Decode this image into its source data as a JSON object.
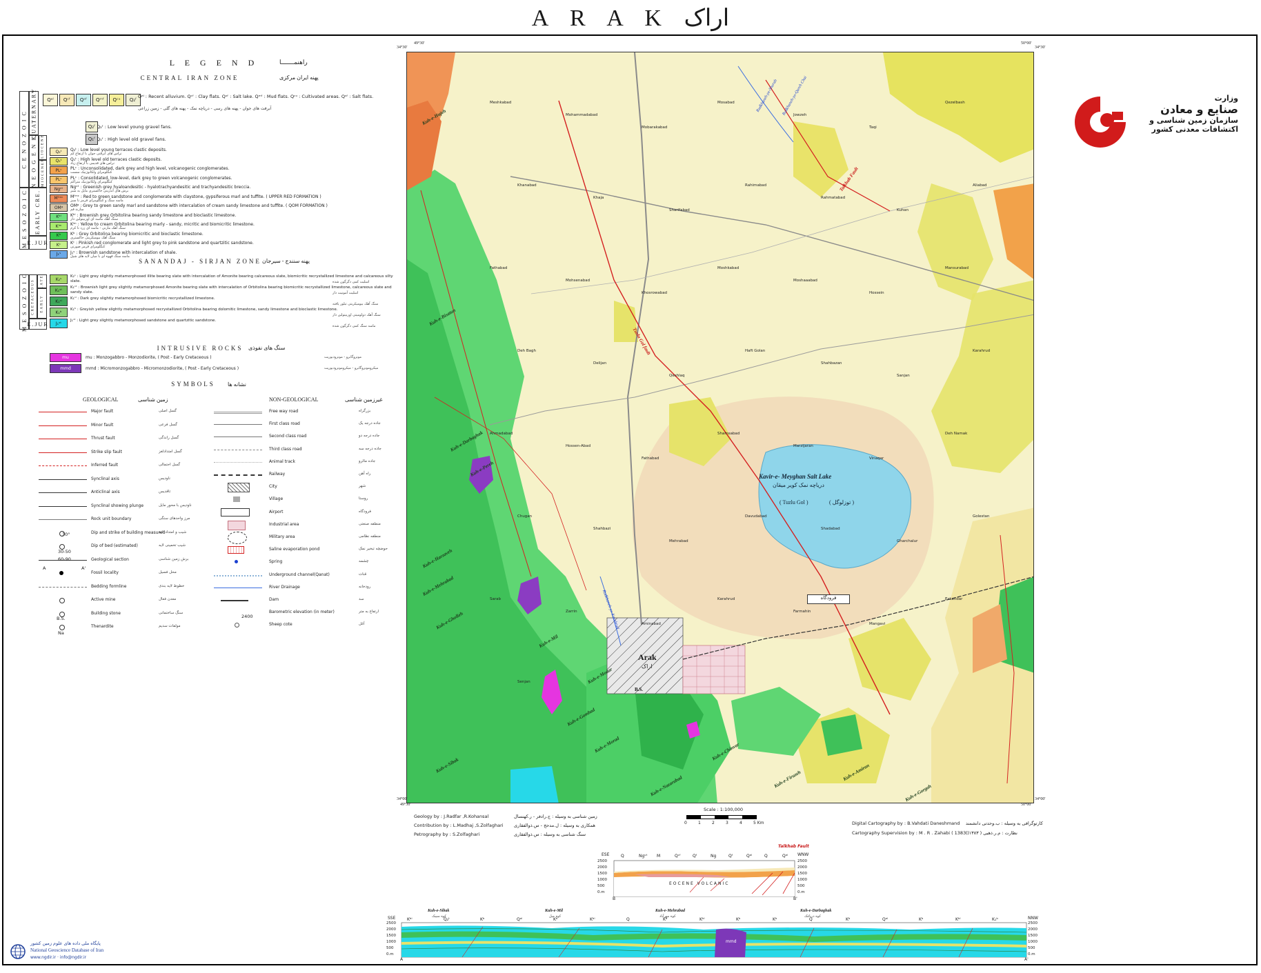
{
  "sheet": {
    "title_latin": "A R A K",
    "title_persian": "اراک"
  },
  "legend": {
    "title": "L E G E N D",
    "title_fa": "راهنمـــــــا",
    "central_zone": "CENTRAL IRAN ZONE",
    "central_zone_fa": "پهنه ایران مرکزی",
    "sanandaj_zone": "SANANDAJ - SIRJAN ZONE",
    "sanandaj_zone_fa": "پهنه سنندج - سیرجان",
    "intrusive": "INTRUSIVE ROCKS",
    "intrusive_fa": "سنگ های نفوذی",
    "symbols": "SYMBOLS",
    "symbols_fa": "نشانه ها",
    "geological": "GEOLOGICAL",
    "geological_fa": "زمین شناسی",
    "non_geological": "NON-GEOLOGICAL",
    "non_geological_fa": "غیرزمین شناسی",
    "eras": {
      "cenozoic": "C E N O Z O I C",
      "mesozoic": "M E S O Z O I C",
      "mesozoic2": "M E S O Z O I C",
      "quaternary": "QUATERNARY",
      "neogene": "N E O G E N E",
      "early_cre": "EARLY CRE.",
      "ejur": "E.JUR",
      "ejur2": "E.JUR",
      "cretaceous": "CRETACEOUS",
      "late": "LATE",
      "early": "EARLY",
      "pliocene": "PLIOCENE",
      "miocene": "MIOCENE"
    },
    "central_units": [
      {
        "code": "Q₂ᵗ",
        "color": "#f6eab5",
        "text": "Q₂ᵗ : Low level young terraces clastic deposits.",
        "fa": "تراس های آبرفتی جوان با ارتفاع کم"
      },
      {
        "code": "Q₁ᵗ",
        "color": "#e9e36a",
        "text": "Q₁ᵗ : High level old terraces clastic deposits.",
        "fa": "تراس های قدیمی با ارتفاع زیاد"
      },
      {
        "code": "PLᶜ",
        "color": "#f3a24c",
        "text": "PLᶜ : Unconsolidated, dark grey and high level, volcanogenic conglomerates.",
        "fa": "کنگلومرای ولکانوژنیک سست"
      },
      {
        "code": "PLᶜ",
        "color": "#f9c66d",
        "text": "PLᶜ : Consolidated, low-level, dark grey to green volcanogenic conglomerates.",
        "fa": "کنگلومرای ولکانوژنیک متراکم"
      },
      {
        "code": "Ngᵛᵗ",
        "color": "#e7b28a",
        "text": "Ngᵛᵗ : Greenish grey hyaloandesitic - hyalotrachyandesitic and trachyandesitic breccia.",
        "fa": "برش های آندزیتی خاکستری مایل به سبز"
      },
      {
        "code": "Mᶠᵐᶜ",
        "color": "#ee8a58",
        "text": "Mᶠᵐᶜ : Red to green sandstone and conglomerate with claystone, gypsiferous marl and tuffite. ( UPPER RED FORMATION )",
        "fa": "ماسه سنگ و کنگلومرای قرمز تا سبز"
      },
      {
        "code": "OMᵍ",
        "color": "#d7c5a8",
        "text": "OMᵍ : Grey to green sandy marl and sandstone with intercalation of cream sandy limestone and tuffite. ( QOM FORMATION )",
        "fa": "سازند قم"
      },
      {
        "code": "Kᵇˡ",
        "color": "#6fe07e",
        "text": "Kᵇˡ : Brownish grey Orbitolina bearing sandy limestone and bioclastic limestone.",
        "fa": "سنگ آهک ماسه ای اوربیتولین دار"
      },
      {
        "code": "Kˡᵐ",
        "color": "#a8ea6e",
        "text": "Kˡᵐ : Yellow to cream Orbitolina bearing marly - sandy, micritic and biomicritic limestone.",
        "fa": "سنگ آهک مارنی - ماسه ای زرد تا کرم"
      },
      {
        "code": "Kᵇ",
        "color": "#34c94c",
        "text": "Kᵇ : Grey Orbitolina bearing biomicritic and bioclastic limestone.",
        "fa": "سنگ آهک بیومیکریتی خاکستری"
      },
      {
        "code": "Kᶜ",
        "color": "#c6f08a",
        "text": "Kᶜ : Pinkish red conglomerate and light grey to pink sandstone and quartzitic sandstone.",
        "fa": "کنگلومرای قرمز صورتی"
      },
      {
        "code": "J₁ˢ",
        "color": "#6aa8e8",
        "text": "J₁ˢ : Brownish sandstone with intercalation of shale.",
        "fa": "ماسه سنگ قهوه ای با میان لایه های شیل"
      }
    ],
    "sanandaj_units": [
      {
        "code": "K₂ˢ",
        "color": "#a7d86a",
        "text": "K₂ˢ : Light grey slightly metamorphosed illite bearing slate with intercalation of Amonite bearing calcareous slate, biomicritic recrystallized limestone and calcareous silty slate.",
        "fa": "اسلیت کمی دگرگون شده"
      },
      {
        "code": "K₁ˢᵗ",
        "color": "#6fbf5a",
        "text": "K₁ˢᵗ : Brownish light grey slightly metamorphosed Amonite bearing slate with intercalation of Orbitolina bearing biomicritic recrystallized limestone, calcareous slate and sandy slate.",
        "fa": "اسلیت آمونیت دار"
      },
      {
        "code": "K₁ˢˡ",
        "color": "#3ea85a",
        "text": "K₁ˢˡ : Dark grey slightly metamorphosed biomicritic recrystallized limestone.",
        "fa": "سنگ آهک بیومیکریتی تبلور یافته"
      },
      {
        "code": "K₁ᵇ",
        "color": "#8fd27a",
        "text": "K₁ᵇ : Greyish yellow slightly metamorphosed recrystallized Orbitolina bearing dolomitic limestone, sandy limestone and bioclastic limestone.",
        "fa": "سنگ آهک دولومیتی اوربیتولین دار"
      },
      {
        "code": "J₁ˢᵗ",
        "color": "#27d8e8",
        "text": "J₁ˢᵗ : Light grey slightly metamorphosed sandstone and quartzitic sandstone.",
        "fa": "ماسه سنگ کمی دگرگون شده"
      }
    ],
    "quaternary_top": [
      {
        "code": "Qᵃˡ",
        "color": "#fbf6d8"
      },
      {
        "code": "Qᶜᶠ",
        "color": "#f7e9b8"
      },
      {
        "code": "Qˢᶠ",
        "color": "#c7f0ef"
      },
      {
        "code": "Qᵐᶠ",
        "color": "#f2f2c8"
      },
      {
        "code": "Qᶜᵘ",
        "color": "#f6ef9a"
      },
      {
        "code": "Q₂ᶠ",
        "color": "#f0f0d4"
      }
    ],
    "quaternary_top_text": "Qᵃˡ : Recent alluvium.   Qᶜᶠ : Clay flats.   Qˢᶠ : Salt lake.   Qᵐᶠ : Mud flats.   Qᶜᵘ : Cultivated areas.   Qˢᶠ : Salt flats.",
    "quaternary_top_fa": "آبرفت های جوان - پهنه های رسی - دریاچه نمک - پهنه های گلی - زمین زراعی",
    "q2f_text": "Q₂ᶠ : Low level young gravel fans.",
    "q1f_text": "Q₁ᶠ : High level old gravel fans.",
    "intrusive_units": [
      {
        "code": "mu",
        "color": "#e535e0",
        "text": "mu : Monzogabbro - Monzodiorite, ( Post - Early Cretaceous )",
        "fa": "مونزوگابرو - مونزودیوریت"
      },
      {
        "code": "mmd",
        "color": "#7d38b8",
        "text": "mmd : Micromonzogabbro - Micromonzodiorite, ( Post - Early Cretaceous )",
        "fa": "میکرومونزوگابرو - میکرومونزودیوریت"
      }
    ],
    "geo_symbols": [
      {
        "name": "Major fault",
        "fa": "گسل اصلی"
      },
      {
        "name": "Minor fault",
        "fa": "گسل فرعی"
      },
      {
        "name": "Thrust fault",
        "fa": "گسل راندگی"
      },
      {
        "name": "Strike slip fault",
        "fa": "گسل امتدادلغز"
      },
      {
        "name": "Inferred fault",
        "fa": "گسل احتمالی"
      },
      {
        "name": "Synclinal axis",
        "fa": "ناودیس"
      },
      {
        "name": "Anticlinal axis",
        "fa": "تاقدیس"
      },
      {
        "name": "Synclinal showing plunge",
        "fa": "ناودیس با محور مایل"
      },
      {
        "name": "Rock unit boundary",
        "fa": "مرز واحدهای سنگی"
      },
      {
        "name": "Dip and strike of building measured",
        "fa": "شیب و امتداد لایه"
      },
      {
        "name": "Dip of bed (estimated)",
        "fa": "شیب تخمینی لایه"
      },
      {
        "name": "Geological section",
        "fa": "برش زمین شناسی"
      },
      {
        "name": "Fossil locality",
        "fa": "محل فسیل"
      },
      {
        "name": "Bedding formline",
        "fa": "خطوط لایه بندی"
      },
      {
        "name": "Active mine",
        "fa": "معدن فعال"
      },
      {
        "name": "Building stone",
        "fa": "سنگ ساختمانی"
      },
      {
        "name": "Thenardite",
        "fa": "مولفات سدیم"
      }
    ],
    "geo_extra": {
      "dip": "30°",
      "dip2": "30-50",
      "dip3": "60-90",
      "section_a": "A",
      "section_a2": "A'",
      "bs": "B.S.",
      "na": "Na"
    },
    "nongeo_symbols": [
      {
        "name": "Free way road",
        "fa": "بزرگراه"
      },
      {
        "name": "First class road",
        "fa": "جاده درجه یک"
      },
      {
        "name": "Second class road",
        "fa": "جاده درجه دو"
      },
      {
        "name": "Third class road",
        "fa": "جاده درجه سه"
      },
      {
        "name": "Animal track",
        "fa": "جاده مالرو"
      },
      {
        "name": "Railway",
        "fa": "راه آهن"
      },
      {
        "name": "City",
        "fa": "شهر"
      },
      {
        "name": "Village",
        "fa": "روستا"
      },
      {
        "name": "Airport",
        "fa": "فرودگاه"
      },
      {
        "name": "Industrial area",
        "fa": "منطقه صنعتی"
      },
      {
        "name": "Military area",
        "fa": "منطقه نظامی"
      },
      {
        "name": "Saline evaporation pond",
        "fa": "حوضچه تبخیر نمک"
      },
      {
        "name": "Spring",
        "fa": "چشمه"
      },
      {
        "name": "Underground channel(Qanat)",
        "fa": "قنات"
      },
      {
        "name": "River Drainage",
        "fa": "رودخانه"
      },
      {
        "name": "Dam",
        "fa": "سد"
      },
      {
        "name": "Barometric elevation (in meter)",
        "fa": "ارتفاع به متر"
      },
      {
        "name": "Sheep cote",
        "fa": "آغل"
      }
    ],
    "elev_example": "2400"
  },
  "map": {
    "corners": {
      "nw": "34°30'",
      "nw_lon": "49°30'",
      "ne": "34°30'",
      "ne_lon": "50°00'",
      "sw": "34°00'",
      "sw_lon": "49°30'",
      "se": "34°00'",
      "se_lon": "50°00'"
    },
    "lake_name": "Kavir-e- Meyghan Salt Lake",
    "lake_name_fa": "دریاچه نمک کویر میقان",
    "lake_sub": "( Tuzlu Gol )",
    "lake_sub_fa": "( توزلوگل )",
    "city": "Arak",
    "city_fa": "اراک",
    "fault_talkhab": "Talkhab Fault",
    "fault_tuzlu": "Tuzlu Gol fault",
    "river_1": "Rudkhaneh-ye-Shurab",
    "river_2": "Rudkhaneh-ye-Qareh Chai",
    "river_3": "Rudkhaneh-ye-Karahrud",
    "airport": "فرودگاه",
    "bs": "B.S.",
    "mountains": [
      "Kuh-e-Hujeh",
      "Kuh-e-Bisatun",
      "Kuh-e-Darbaghak",
      "Kuh-e-Pereh",
      "Kuh-e-Harzaveh",
      "Kuh-e-Mehrabad",
      "Kuh-e-Gholleh",
      "Kuh-e-Mil",
      "Kuh-e-Modar",
      "Kuh-e-Gombad",
      "Kuh-e-Morad",
      "Kuh-e-Sibak",
      "Kuh-e-Nazarabad",
      "Kuh-e-Chinvar",
      "Kuh-e-Firuzeh",
      "Kuh-e-Amiran",
      "Kuh-e-Gorgah"
    ],
    "places": [
      "Meshkabad",
      "Mohammadabad",
      "Mobarakabad",
      "Mosabad",
      "Jowzeh",
      "Taqi",
      "Qezelbash",
      "Khanabad",
      "Khaja",
      "Sharifabad",
      "Rahimabad",
      "Rahmatabad",
      "Kuhan",
      "Aliabad",
      "Fathabad",
      "Mohsenabad",
      "Khosrowabad",
      "Moshkabad",
      "Moshaaabad",
      "Hossein",
      "Mansurabad",
      "Deh Bagh",
      "Delijan",
      "Qeshlaq",
      "Haft Golan",
      "Shahbazan",
      "Sanjan",
      "Karahrud",
      "Ahmadabad",
      "Hossen-Abad",
      "Fathabad",
      "Shamsabad",
      "Marzijaran",
      "Vinaqar",
      "Deh Namak",
      "Chugan",
      "Shahbazi",
      "Mehrabad",
      "Davudabad",
      "Shadabad",
      "Gharchalur",
      "Golestan",
      "Sarab",
      "Zarrin",
      "Aminabad",
      "Karahrud",
      "Farmahin",
      "Mangavi",
      "Eskandar",
      "Senjan"
    ]
  },
  "logo": {
    "line1": "وزارت",
    "line2": "صنایع و معادن",
    "line3": "سازمان زمین شناسی و",
    "line4": "اکتشافات معدنی کشور"
  },
  "scale": {
    "label": "Scale : 1:100,000",
    "ticks": [
      "0",
      "1",
      "2",
      "3",
      "4",
      "5 Km"
    ]
  },
  "credits": {
    "geology": "Geology by : J.Radfar ,R.Kohansal",
    "geology_fa": "زمین شناسی به وسیله : ج.رادفر - ر.کهنسال",
    "contribution": "Contribution by : L.Madhaj ,S.Zolfaghari",
    "contribution_fa": "همکاری به وسیله : ل.مدحج - س.ذوالفقاری",
    "petrography": "Petrography by : S.Zolfaghari",
    "petrography_fa": "سنگ شناسی به وسیله : س.ذوالفقاری",
    "digital": "Digital Cartography by : B.Vahdati Daneshmand",
    "digital_fa": "کارتوگرافی به وسیله : ب.وحدتی دانشمند",
    "supervision": "Cartography Supervision by : M . R . Zahabi ( 1383 )",
    "supervision_fa": "نظارت : م.ر.ذهبی ( ۱۳۸۳ )"
  },
  "section_small": {
    "left": "ESE",
    "right": "WNW",
    "fault": "Talkhab Fault",
    "label": "EOCENE VOLCANIC",
    "ticks": [
      "2500",
      "2000",
      "1500",
      "1000",
      "500",
      "0.m"
    ],
    "b": "B",
    "b2": "B'",
    "units": [
      "Q",
      "Ngᵛᵗ",
      "M",
      "Qᶜᶠ",
      "Qᶠ",
      "Ng",
      "Qᶠ",
      "Qᵃˡ",
      "Q",
      "Qᵃˡ"
    ]
  },
  "section_large": {
    "left": "SSE",
    "right": "NNW",
    "ticks": [
      "2500",
      "2000",
      "1500",
      "1000",
      "500",
      "0.m"
    ],
    "a": "A",
    "a2": "A'",
    "mountains": [
      {
        "name": "Kuh-e-Sibak",
        "fa": "کوه سیبک"
      },
      {
        "name": "Kuh-e-Mil",
        "fa": "کوه میل"
      },
      {
        "name": "Kuh-e-Mehrabad",
        "fa": "کوه مهرآباد"
      },
      {
        "name": "Kuh-e-Darbaghak",
        "fa": "کوه درباغک"
      }
    ],
    "units": [
      "Kᵇˡ",
      "Q₂ᵗ",
      "Kᵇ",
      "Qᵃˡ",
      "Kᵇ",
      "Kᵇˡ",
      "Q",
      "Kᵇ",
      "Kᵇˡ",
      "Kᵇ",
      "Kᵇ",
      "Q",
      "Kᵇ",
      "Qᵃˡ",
      "Kᵇ",
      "Kᵇˡ",
      "K₁ᵇ"
    ],
    "intrusion": "mmd"
  },
  "ngdb": {
    "line1": "پایگاه ملی داده های علوم زمین کشور",
    "line2": "National Geoscience Database of Iran",
    "line3": "www.ngdir.ir  ·  info@ngdir.ir"
  }
}
